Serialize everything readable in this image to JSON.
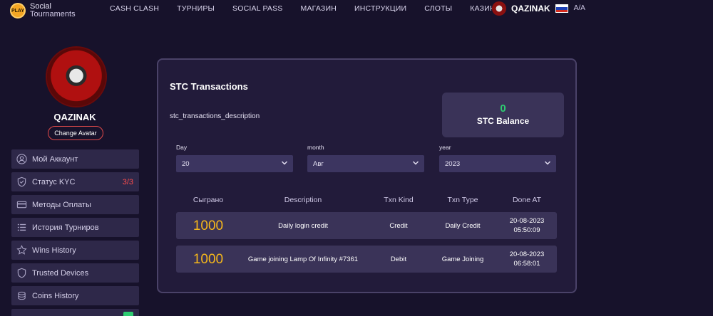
{
  "brand": {
    "badge": "PLAY",
    "line1": "Social",
    "line2": "Tournaments"
  },
  "nav": [
    "CASH CLASH",
    "ТУРНИРЫ",
    "SOCIAL PASS",
    "МАГАЗИН",
    "ИНСТРУКЦИИ",
    "СЛОТЫ",
    "КАЗИНО"
  ],
  "user": {
    "name": "QAZINAK",
    "lang_icon": "A/A"
  },
  "profile": {
    "name": "QAZINAK",
    "change_avatar": "Change Avatar"
  },
  "menu": [
    {
      "label": "Мой Аккаунт",
      "icon": "user-icon"
    },
    {
      "label": "Статус KYC",
      "icon": "shield-check-icon",
      "badge": "3/3"
    },
    {
      "label": "Методы Оплаты",
      "icon": "card-icon"
    },
    {
      "label": "История Турниров",
      "icon": "list-icon"
    },
    {
      "label": "Wins History",
      "icon": "star-icon"
    },
    {
      "label": "Trusted Devices",
      "icon": "shield-icon"
    },
    {
      "label": "Coins History",
      "icon": "coins-icon"
    }
  ],
  "card": {
    "title": "STC Transactions",
    "description": "stc_transactions_description",
    "balance_value": "0",
    "balance_label": "STC Balance",
    "filters": {
      "day": {
        "label": "Day",
        "value": "20"
      },
      "month": {
        "label": "month",
        "value": "Авг"
      },
      "year": {
        "label": "year",
        "value": "2023"
      }
    },
    "columns": [
      "Сыграно",
      "Description",
      "Txn Kind",
      "Txn Type",
      "Done AT"
    ],
    "rows": [
      {
        "amount": "1000",
        "description": "Daily login credit",
        "kind": "Credit",
        "type": "Daily Credit",
        "date": "20-08-2023",
        "time": "05:50:09"
      },
      {
        "amount": "1000",
        "description": "Game joining Lamp Of Infinity #7361",
        "kind": "Debit",
        "type": "Game Joining",
        "date": "20-08-2023",
        "time": "06:58:01"
      }
    ]
  },
  "colors": {
    "background": "#17122b",
    "accent_gold": "#f5b71b",
    "balance_green": "#2ecc71",
    "kyc_red": "#ff4d4d"
  }
}
